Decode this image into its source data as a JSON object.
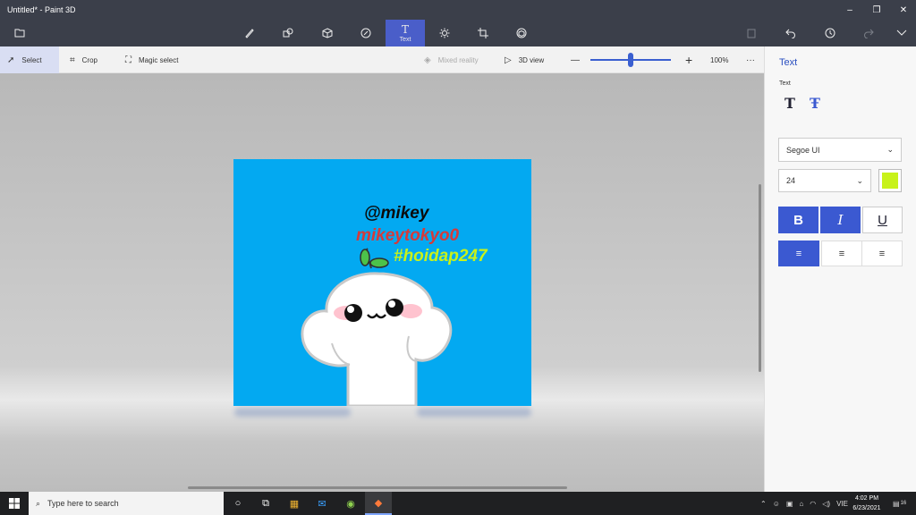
{
  "window": {
    "title": "Untitled* - Paint 3D",
    "minimize": "–",
    "restore": "❐",
    "close": "✕"
  },
  "main_toolbar": {
    "active_label": "Text",
    "active_glyph": "T",
    "icons": [
      "menu-folder-icon",
      "brushes-icon",
      "2d-shapes-icon",
      "3d-shapes-icon",
      "stickers-icon",
      "text-icon",
      "effects-icon",
      "canvas-icon",
      "3d-library-icon",
      "paste-icon",
      "undo-icon",
      "history-icon",
      "redo-icon",
      "expand-icon"
    ]
  },
  "sub_toolbar": {
    "select": "Select",
    "crop": "Crop",
    "magic_select": "Magic select",
    "mixed_reality": "Mixed reality",
    "view_3d": "3D view",
    "zoom_out": "—",
    "zoom_in": "+",
    "zoom_value": "100%",
    "zoom_fraction": 0.5,
    "more": "···"
  },
  "canvas": {
    "bg_color": "#03a9f1",
    "texts": [
      {
        "text": "@mikey",
        "color": "#0b0b0b"
      },
      {
        "text": "mikeytokyo0",
        "color": "#d63a3a"
      },
      {
        "text": "#hoidap247",
        "color": "#c8f21a"
      }
    ]
  },
  "panel": {
    "title": "Text",
    "subtitle": "Text",
    "font": "Segoe UI",
    "size": "24",
    "color": "#c8f21a",
    "bold": "B",
    "italic": "I",
    "underline": "U",
    "align_left": "≡",
    "align_center": "≡",
    "align_right": "≡"
  },
  "taskbar": {
    "search_placeholder": "Type here to search",
    "language": "VIE",
    "time": "4:02 PM",
    "date": "6/23/2021",
    "notif_count": "16"
  }
}
